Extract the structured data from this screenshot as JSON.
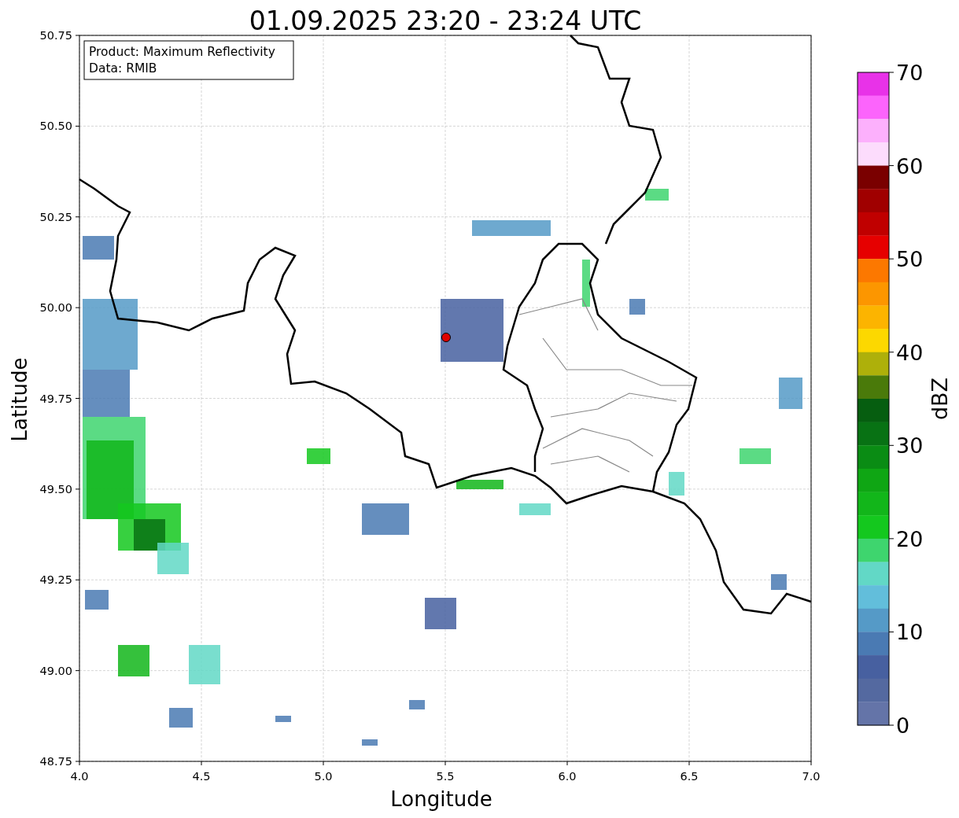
{
  "title": "01.09.2025 23:20 - 23:24 UTC",
  "legend": [
    "Product: Maximum Reflectivity",
    "Data: RMIB"
  ],
  "x_axis": {
    "label": "Longitude",
    "ticks": [
      "4.0",
      "4.5",
      "5.0",
      "5.5",
      "6.0",
      "6.5",
      "7.0"
    ]
  },
  "y_axis": {
    "label": "Latitude",
    "ticks": [
      "50.75",
      "50.50",
      "50.25",
      "50.00",
      "49.75",
      "49.50",
      "49.25",
      "49.00",
      "48.75"
    ]
  },
  "colorbar": {
    "label": "dBZ",
    "ticks": [
      "70",
      "60",
      "50",
      "40",
      "30",
      "20",
      "10",
      "0"
    ],
    "bins": [
      {
        "color": "#e832e8"
      },
      {
        "color": "#fc64fc"
      },
      {
        "color": "#fcb0fc"
      },
      {
        "color": "#fcdcfc"
      },
      {
        "color": "#7a0000"
      },
      {
        "color": "#a00000"
      },
      {
        "color": "#c00000"
      },
      {
        "color": "#e60000"
      },
      {
        "color": "#fc7800"
      },
      {
        "color": "#fc9600"
      },
      {
        "color": "#fcb400"
      },
      {
        "color": "#fcd800"
      },
      {
        "color": "#aeb00a"
      },
      {
        "color": "#4a7a0a"
      },
      {
        "color": "#065e10"
      },
      {
        "color": "#087214"
      },
      {
        "color": "#0a8c14"
      },
      {
        "color": "#0fa614"
      },
      {
        "color": "#12b61a"
      },
      {
        "color": "#14c81e"
      },
      {
        "color": "#3ed56e"
      },
      {
        "color": "#62d8c6"
      },
      {
        "color": "#62bedb"
      },
      {
        "color": "#559ac7"
      },
      {
        "color": "#4a7ab3"
      },
      {
        "color": "#4760a0"
      },
      {
        "color": "#5469a0"
      },
      {
        "color": "#6474a8"
      }
    ]
  }
}
